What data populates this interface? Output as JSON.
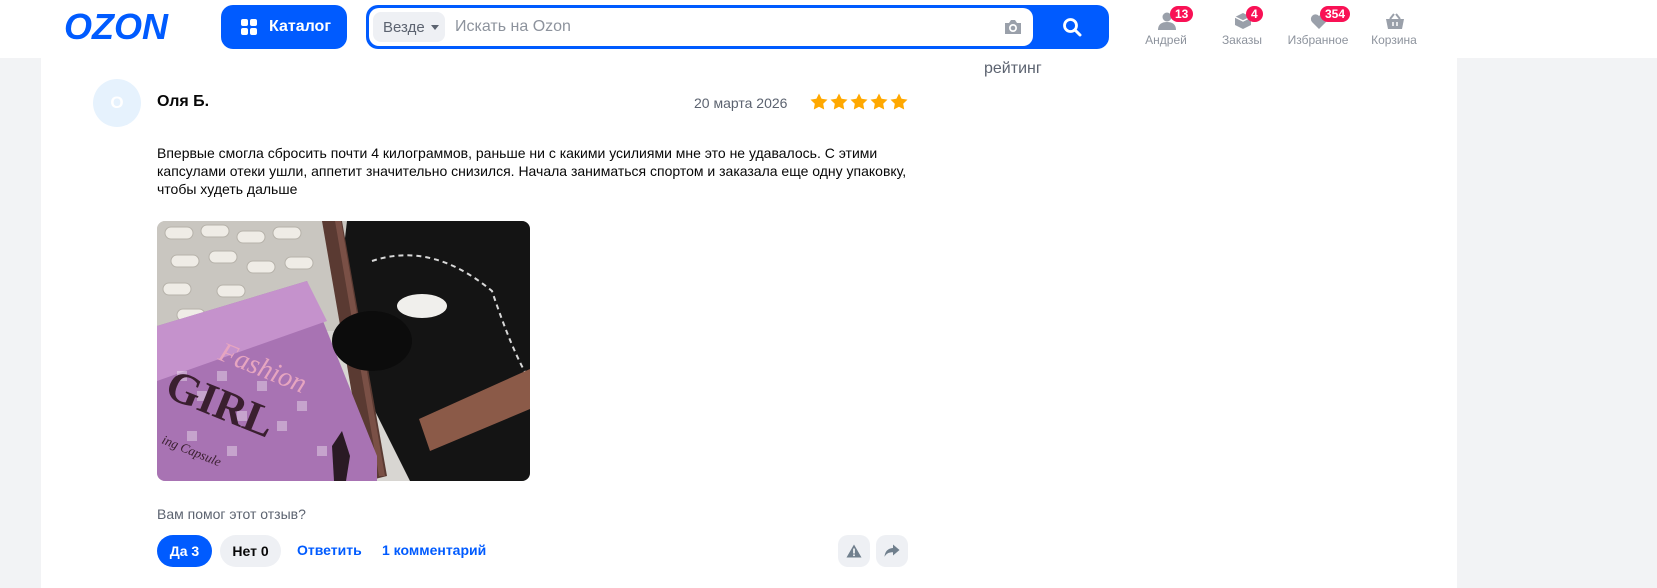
{
  "header": {
    "logo_text": "OZON",
    "catalog_label": "Каталог",
    "search": {
      "scope": "Везде",
      "placeholder": "Искать на Ozon",
      "value": ""
    },
    "nav": [
      {
        "label": "Андрей",
        "badge": "13",
        "icon": "user-icon"
      },
      {
        "label": "Заказы",
        "badge": "4",
        "icon": "box-icon"
      },
      {
        "label": "Избранное",
        "badge": "354",
        "icon": "heart-icon"
      },
      {
        "label": "Корзина",
        "badge": "",
        "icon": "basket-icon"
      }
    ],
    "colors": {
      "brand": "#005bff",
      "badge": "#f91155"
    }
  },
  "sidebar": {
    "rating_word": "рейтинг"
  },
  "review": {
    "avatar_letter": "О",
    "author": "Оля Б.",
    "date": "20 марта 2026",
    "rating": 5,
    "star_color": "#ffa800",
    "text": "Впервые смогла сбросить почти 4 килограммов, раньше ни с какими усилиями мне это не удавалось. С этими капсулами отеки ушли, аппетит значительно снизился. Начала заниматься спортом и заказала еще одну упаковку, чтобы худеть дальше",
    "photo": {
      "box_text_1": "Fashion",
      "box_text_2": "GIRL",
      "box_text_3": "ing Capsule"
    },
    "helpful_question": "Вам помог этот отзыв?",
    "yes_label": "Да 3",
    "no_label": "Нет 0",
    "reply_label": "Ответить",
    "comments_label": "1 комментарий"
  }
}
